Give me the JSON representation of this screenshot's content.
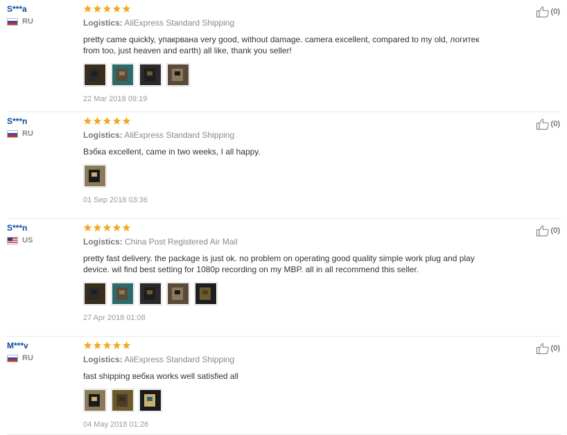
{
  "reviews": [
    {
      "user": "S***a",
      "country": "RU",
      "flag": "ru",
      "rating": 5,
      "logistics_label": "Logistics:",
      "logistics_value": "AliExpress Standard Shipping",
      "text": "pretty came quickly, упакрвана very good, without damage. camera excellent, compared to my old, логитек from too, just heaven and earth) all like, thank you seller!",
      "photos": [
        "photo-1",
        "photo-2",
        "photo-3",
        "photo-4"
      ],
      "date": "22 Mar 2018 09:19",
      "helpful_count": "(0)"
    },
    {
      "user": "S***n",
      "country": "RU",
      "flag": "ru",
      "rating": 5,
      "logistics_label": "Logistics:",
      "logistics_value": "AliExpress Standard Shipping",
      "text": "Вэбка excellent, came in two weeks, I all happy.",
      "photos": [
        "photo-1"
      ],
      "date": "01 Sep 2018 03:36",
      "helpful_count": "(0)"
    },
    {
      "user": "S***n",
      "country": "US",
      "flag": "us",
      "rating": 5,
      "logistics_label": "Logistics:",
      "logistics_value": "China Post Registered Air Mail",
      "text": "pretty fast delivery. the package is just ok. no problem on operating good quality simple work plug and play device. wil find best setting for 1080p recording on my MBP. all in all recommend this seller.",
      "photos": [
        "photo-1",
        "photo-2",
        "photo-3",
        "photo-4",
        "photo-5"
      ],
      "date": "27 Apr 2018 01:08",
      "helpful_count": "(0)"
    },
    {
      "user": "M***v",
      "country": "RU",
      "flag": "ru",
      "rating": 5,
      "logistics_label": "Logistics:",
      "logistics_value": "AliExpress Standard Shipping",
      "text": "fast shipping вебка works well satisfied all",
      "photos": [
        "photo-1",
        "photo-2",
        "photo-3"
      ],
      "date": "04 May 2018 01:26",
      "helpful_count": "(0)"
    }
  ],
  "colors": {
    "star": "#f5a623",
    "username": "#0a4aa0",
    "muted": "#888888",
    "divider": "#e8e8e8"
  },
  "icons": {
    "star": "star-icon",
    "helpful": "thumbs-up-icon",
    "flag": "flag-icon"
  }
}
